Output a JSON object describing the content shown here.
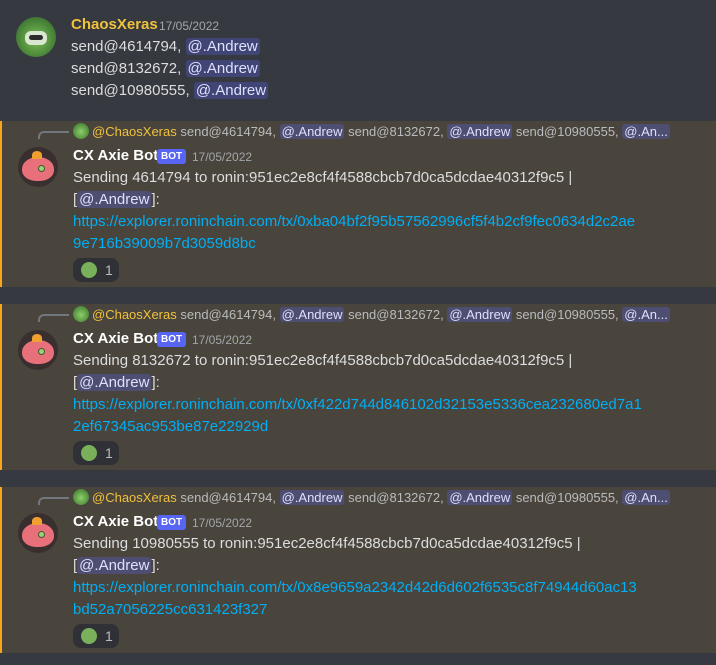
{
  "first_message": {
    "username": "ChaosXeras",
    "timestamp": "17/05/2022",
    "lines": [
      {
        "text": "send@4614794, ",
        "mention": "@.Andrew"
      },
      {
        "text": "send@8132672, ",
        "mention": "@.Andrew"
      },
      {
        "text": "send@10980555, ",
        "mention": "@.Andrew"
      }
    ]
  },
  "replies": [
    {
      "reply_preview": {
        "author": "@ChaosXeras",
        "segments": [
          {
            "text": " send@4614794, ",
            "mention": "@.Andrew"
          },
          {
            "text": " send@8132672, ",
            "mention": "@.Andrew"
          },
          {
            "text": " send@10980555, ",
            "mention": "@.An..."
          }
        ]
      },
      "username": "CX Axie Bot",
      "badge": "BOT",
      "timestamp": "17/05/2022",
      "line1": "Sending 4614794 to ronin:951ec2e8cf4f4588cbcb7d0ca5dcdae40312f9c5 |",
      "line2_prefix": "[",
      "line2_mention": "@.Andrew",
      "line2_suffix": "]:",
      "link_line1": "https://explorer.roninchain.com/tx/0xba04bf2f95b57562996cf5f4b2cf9fec0634d2c2ae",
      "link_line2": "9e716b39009b7d3059d8bc",
      "reaction_count": "1"
    },
    {
      "reply_preview": {
        "author": "@ChaosXeras",
        "segments": [
          {
            "text": " send@4614794, ",
            "mention": "@.Andrew"
          },
          {
            "text": " send@8132672, ",
            "mention": "@.Andrew"
          },
          {
            "text": " send@10980555, ",
            "mention": "@.An..."
          }
        ]
      },
      "username": "CX Axie Bot",
      "badge": "BOT",
      "timestamp": "17/05/2022",
      "line1": "Sending 8132672 to ronin:951ec2e8cf4f4588cbcb7d0ca5dcdae40312f9c5 |",
      "line2_prefix": "[",
      "line2_mention": "@.Andrew",
      "line2_suffix": "]:",
      "link_line1": "https://explorer.roninchain.com/tx/0xf422d744d846102d32153e5336cea232680ed7a1",
      "link_line2": "2ef67345ac953be87e22929d",
      "reaction_count": "1"
    },
    {
      "reply_preview": {
        "author": "@ChaosXeras",
        "segments": [
          {
            "text": " send@4614794, ",
            "mention": "@.Andrew"
          },
          {
            "text": " send@8132672, ",
            "mention": "@.Andrew"
          },
          {
            "text": " send@10980555, ",
            "mention": "@.An..."
          }
        ]
      },
      "username": "CX Axie Bot",
      "badge": "BOT",
      "timestamp": "17/05/2022",
      "line1": "Sending 10980555 to ronin:951ec2e8cf4f4588cbcb7d0ca5dcdae40312f9c5 |",
      "line2_prefix": "[",
      "line2_mention": "@.Andrew",
      "line2_suffix": "]:",
      "link_line1": "https://explorer.roninchain.com/tx/0x8e9659a2342d42d6d602f6535c8f74944d60ac13",
      "link_line2": "bd52a7056225cc631423f327",
      "reaction_count": "1"
    }
  ],
  "colors": {
    "background": "#36393f",
    "highlight": "#49443c",
    "highlight_border": "#faa61a",
    "username_chaos": "#f0c23c",
    "link": "#00aff4",
    "badge": "#5865f2"
  }
}
